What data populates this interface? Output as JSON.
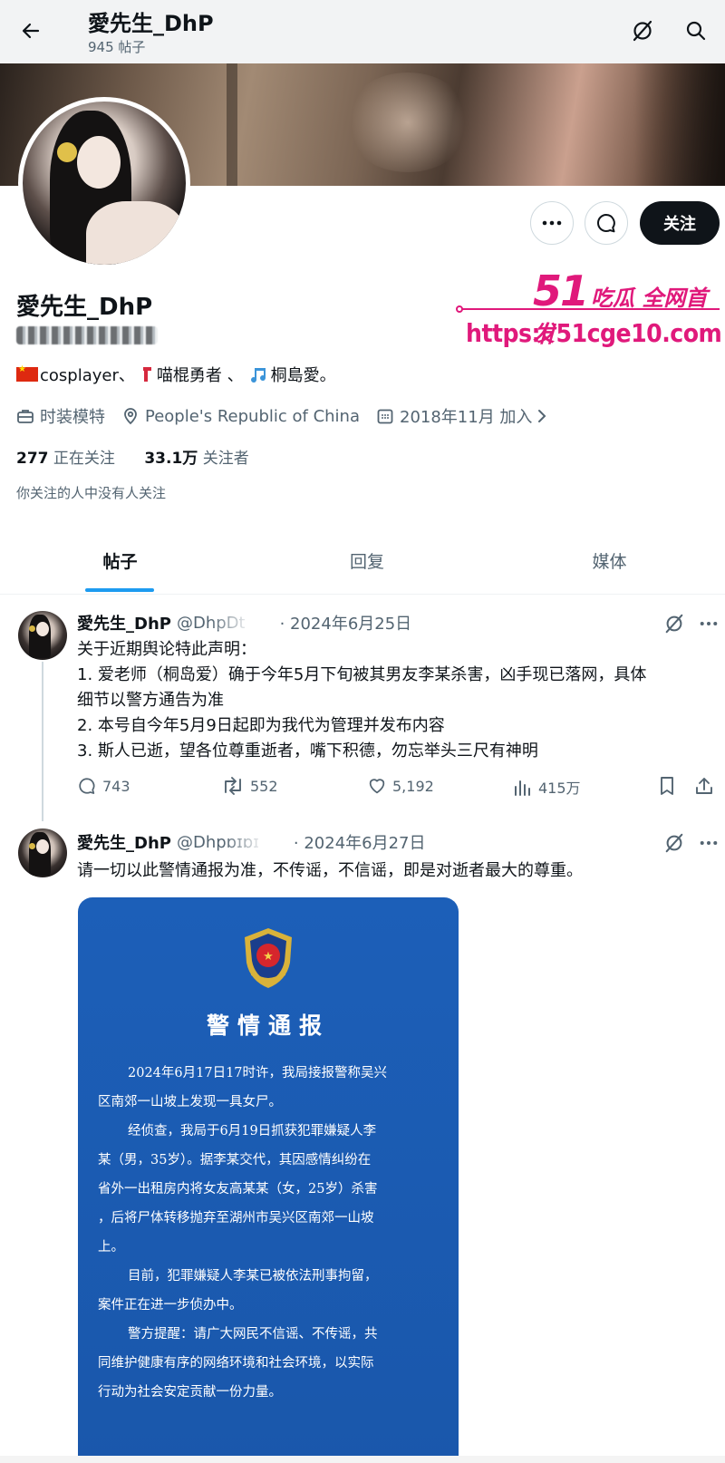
{
  "header": {
    "title": "愛先生_DhP",
    "subtitle": "945 帖子"
  },
  "watermark": {
    "number": "51",
    "slogan": "吃瓜 全网首发",
    "url": "https://51cge10.com"
  },
  "profile": {
    "name": "愛先生_DhP",
    "bio": {
      "flag_icon": "china-flag-icon",
      "part1": "cosplayer、",
      "part2": "喵棍勇者 、",
      "part3": "桐島愛。"
    },
    "category": "时装模特",
    "location": "People's Republic of China",
    "joined": "2018年11月 加入",
    "following_count": "277",
    "following_label": "正在关注",
    "followers_count": "33.1万",
    "followers_label": "关注者",
    "note": "你关注的人中没有人关注",
    "follow_label": "关注"
  },
  "tabs": [
    {
      "label": "帖子",
      "active": true
    },
    {
      "label": "回复",
      "active": false
    },
    {
      "label": "媒体",
      "active": false
    }
  ],
  "posts": [
    {
      "name": "愛先生_DhP",
      "handle": "@DhpDt",
      "date": "· 2024年6月25日",
      "lines": [
        "关于近期舆论特此声明：",
        "1. 爱老师（桐岛爱）确于今年5月下旬被其男友李某杀害，凶手现已落网，具体",
        "细节以警方通告为准",
        "2. 本号自今年5月9日起即为我代为管理并发布内容",
        "3. 斯人已逝，望各位尊重逝者，嘴下积德，勿忘举头三尺有神明"
      ],
      "replies": "743",
      "reposts": "552",
      "likes": "5,192",
      "views": "415万"
    },
    {
      "name": "愛先生_DhP",
      "handle": "@Dhpɒɪɒɪ",
      "date": "· 2024年6月27日",
      "lines": [
        "请一切以此警情通报为准，不传谣，不信谣，即是对逝者最大的尊重。"
      ]
    }
  ],
  "notice": {
    "title": "警情通报",
    "lines": [
      {
        "text": "2024年6月17日17时许，我局接报警称吴兴",
        "indent": true
      },
      {
        "text": "区南郊一山坡上发现一具女尸。",
        "indent": false
      },
      {
        "text": "经侦查，我局于6月19日抓获犯罪嫌疑人李",
        "indent": true
      },
      {
        "text": "某（男，35岁）。据李某交代，其因感情纠纷在",
        "indent": false
      },
      {
        "text": "省外一出租房内将女友高某某（女，25岁）杀害",
        "indent": false
      },
      {
        "text": "，后将尸体转移抛弃至湖州市吴兴区南郊一山坡",
        "indent": false
      },
      {
        "text": "上。",
        "indent": false
      },
      {
        "text": "目前，犯罪嫌疑人李某已被依法刑事拘留，",
        "indent": true
      },
      {
        "text": "案件正在进一步侦办中。",
        "indent": false
      },
      {
        "text": "警方提醒：请广大网民不信谣、不传谣，共",
        "indent": true
      },
      {
        "text": "同维护健康有序的网络环境和社会环境，以实际",
        "indent": false
      },
      {
        "text": "行动为社会安定贡献一份力量。",
        "indent": false
      }
    ]
  },
  "colors": {
    "accent": "#1d9bf0",
    "watermark": "#e0197b",
    "notice_bg": "#1c5fb8"
  }
}
